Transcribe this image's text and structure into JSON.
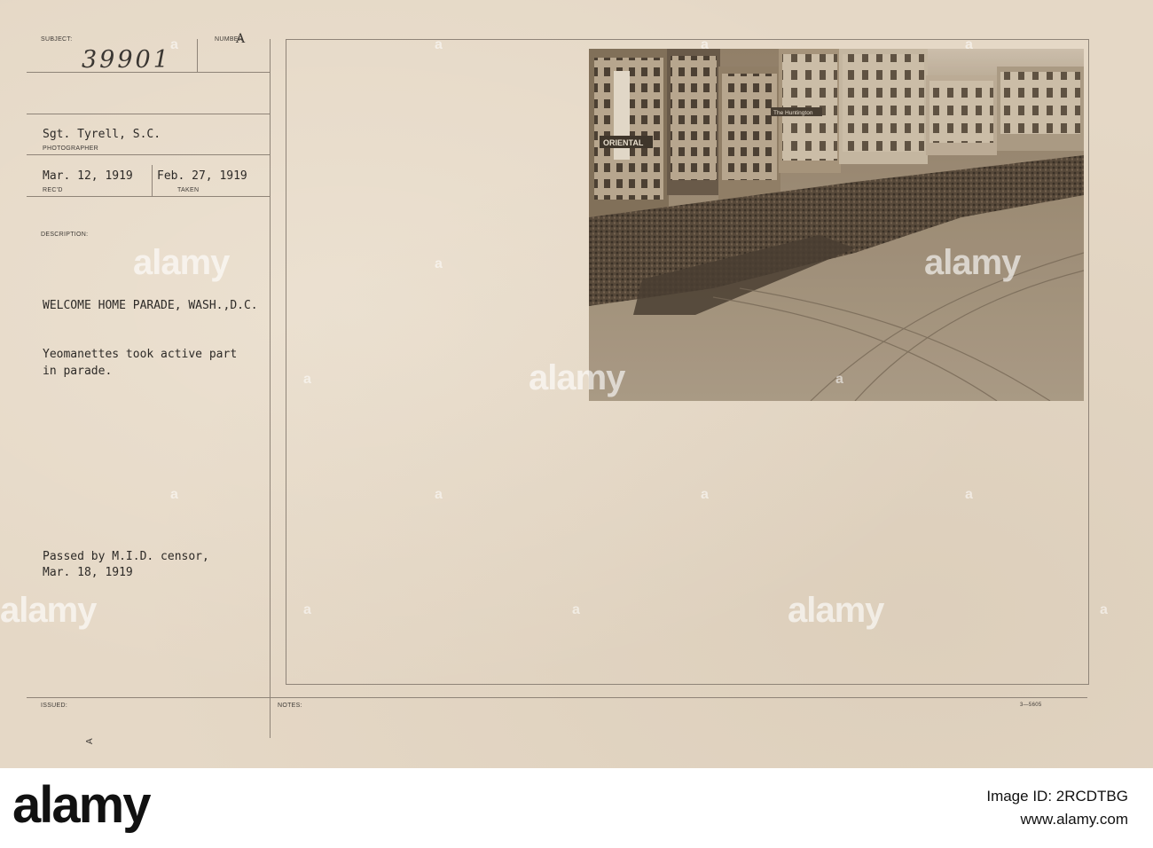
{
  "card": {
    "subject_label": "SUBJECT:",
    "number_label": "NUMBER",
    "number_mark": "A",
    "subject_number": "39901",
    "photographer": "Sgt. Tyrell, S.C.",
    "photographer_label": "PHOTOGRAPHER",
    "received_date": "Mar. 12, 1919",
    "received_label": "REC'D",
    "taken_date": "Feb. 27, 1919",
    "taken_label": "TAKEN",
    "description_label": "DESCRIPTION:",
    "description_title": "WELCOME HOME PARADE, WASH.,D.C.",
    "description_line1": "Yeomanettes took active part",
    "description_line2": "in parade.",
    "censor_line1": "Passed by M.I.D. censor,",
    "censor_line2": "Mar. 18, 1919",
    "issued_label": "ISSUED:",
    "notes_label": "NOTES:",
    "form_number": "3—5605",
    "corner_mark": "A"
  },
  "photo_signs": {
    "theater_sign": "ORIENTAL",
    "shop_sign": "The Huntington"
  },
  "watermark": {
    "text": "alamy"
  },
  "footer": {
    "logo": "alamy",
    "image_id": "Image ID: 2RCDTBG",
    "url": "www.alamy.com"
  },
  "colors": {
    "card": "#e5d8c6",
    "rule": "#8f8478",
    "ink": "#2d2a27",
    "photo_tone": "#9c8b74"
  }
}
